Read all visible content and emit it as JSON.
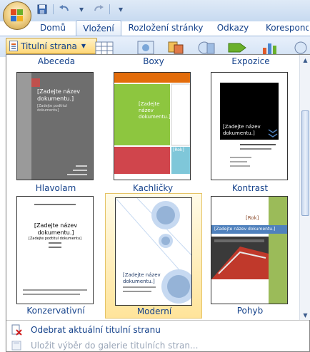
{
  "qat": {
    "items": [
      "save-icon",
      "undo-icon",
      "redo-icon",
      "customize-icon"
    ]
  },
  "tabs": [
    {
      "label": "Domů"
    },
    {
      "label": "Vložení",
      "active": true
    },
    {
      "label": "Rozložení stránky"
    },
    {
      "label": "Odkazy"
    },
    {
      "label": "Korespondence"
    }
  ],
  "ribbon": {
    "cover_page_label": "Titulní strana"
  },
  "gallery": {
    "top_labels": [
      "Abeceda",
      "Boxy",
      "Expozice"
    ],
    "items": [
      {
        "name": "Hlavolam",
        "title": "[Zadejte název dokumentu.]",
        "subtitle": "[Zadejte podtitul dokumentu]"
      },
      {
        "name": "Kachličky",
        "title": "[Zadejte název dokumentu.]",
        "year": "[Rok]"
      },
      {
        "name": "Kontrast",
        "title": "[Zadejte název dokumentu.]"
      },
      {
        "name": "Konzervativní",
        "title": "[Zadejte název dokumentu.]",
        "subtitle": "[Zadejte podtitul dokumentu]"
      },
      {
        "name": "Moderní",
        "title": "[Zadejte název dokumentu.]",
        "selected": true
      },
      {
        "name": "Pohyb",
        "title": "[Zadejte název dokumentu.]",
        "year": "[Rok]"
      }
    ]
  },
  "menu": {
    "remove_label": "Odebrat aktuální titulní stranu",
    "save_label": "Uložit výběr do galerie titulních stran..."
  },
  "colors": {
    "accent": "#15428b",
    "selection": "#ffe49a",
    "tiles_green": "#8dc63f",
    "tiles_red": "#d0454c",
    "pohyb_green": "#9bbb59"
  }
}
